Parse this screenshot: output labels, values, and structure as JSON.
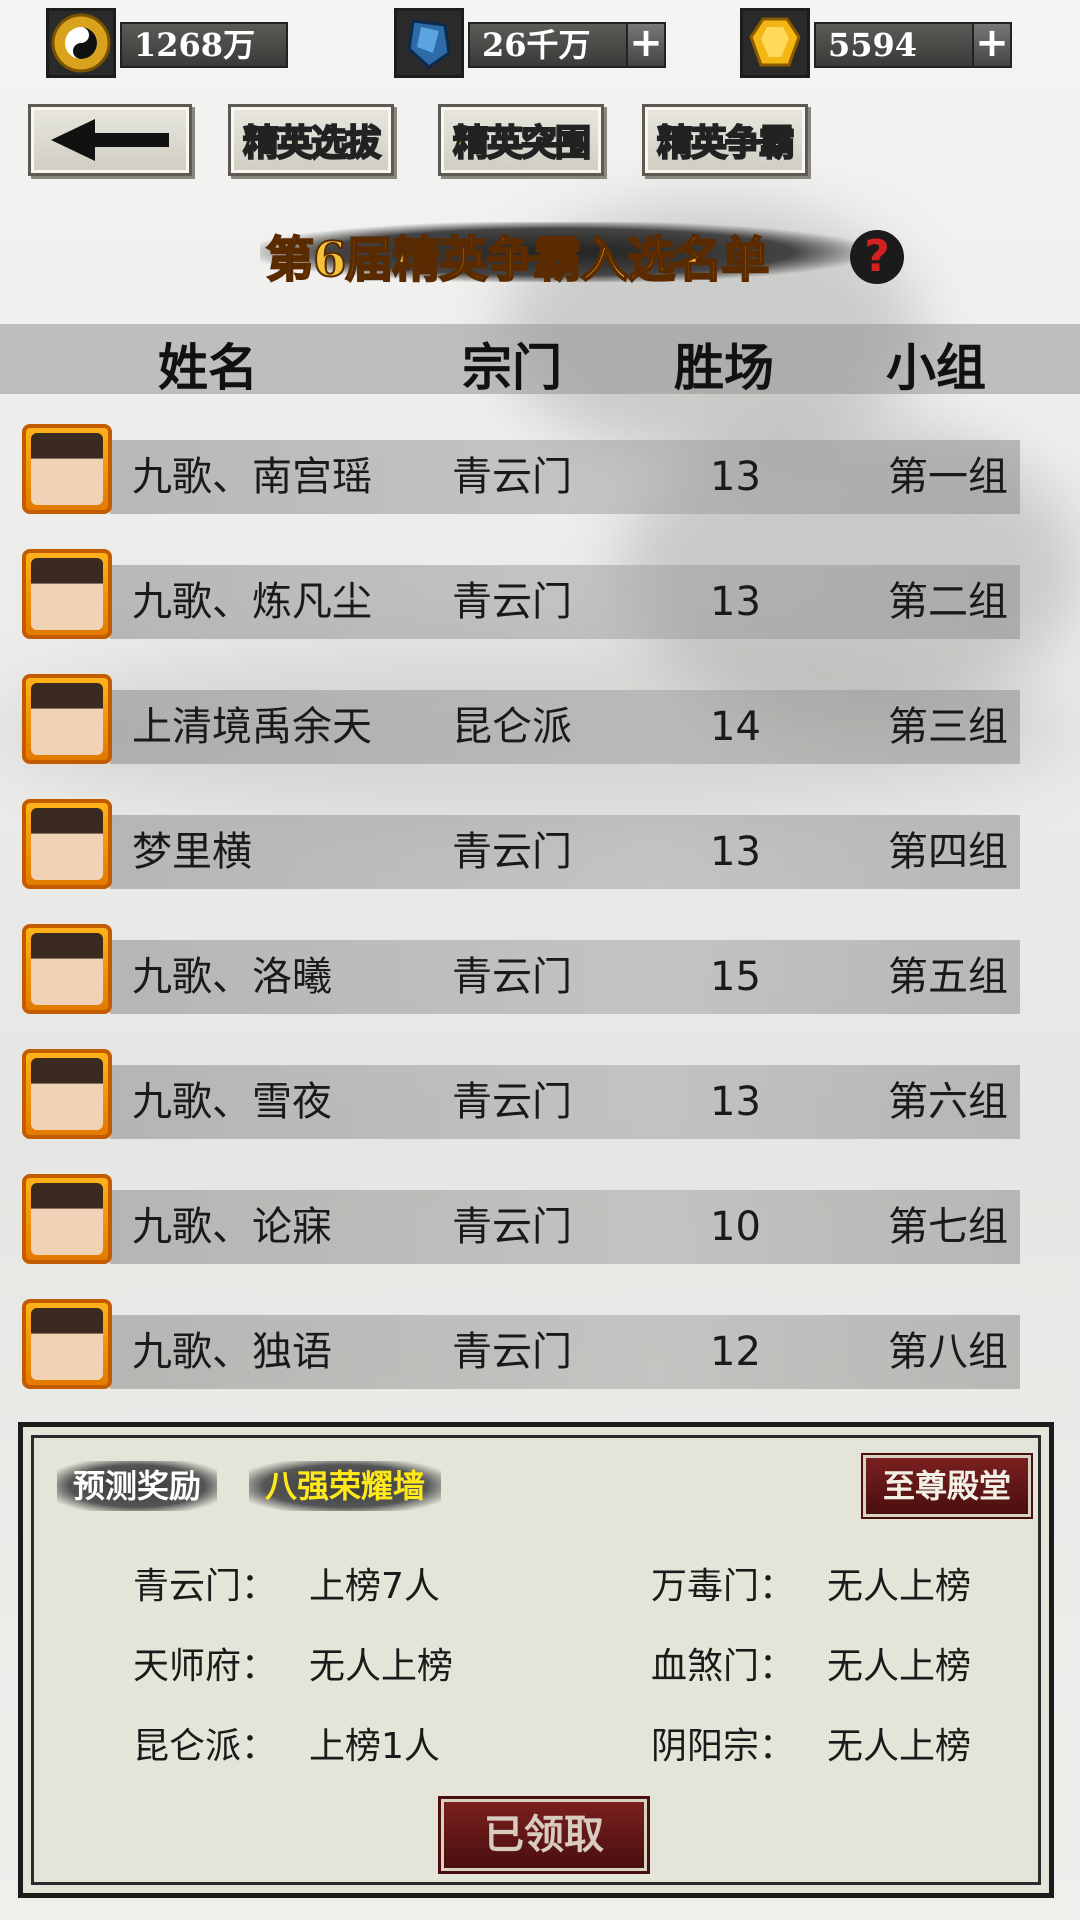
{
  "currency": [
    {
      "icon": "yin-yang-coin-icon",
      "value": "1268万",
      "has_plus": false
    },
    {
      "icon": "blue-crystal-icon",
      "value": "26千万",
      "has_plus": true
    },
    {
      "icon": "gold-gem-icon",
      "value": "5594",
      "has_plus": true
    }
  ],
  "plus_label": "+",
  "nav": {
    "back_icon": "back-arrow-icon",
    "tabs": [
      {
        "label": "精英选拔",
        "active": false
      },
      {
        "label": "精英突围",
        "active": true
      },
      {
        "label": "精英争霸",
        "active": false
      }
    ]
  },
  "title": "第6届精英争霸入选名单",
  "help_label": "?",
  "table": {
    "headers": [
      "姓名",
      "宗门",
      "胜场",
      "小组"
    ],
    "rows": [
      {
        "name": "九歌、南宫瑶",
        "sect": "青云门",
        "wins": "13",
        "group": "第一组"
      },
      {
        "name": "九歌、炼凡尘",
        "sect": "青云门",
        "wins": "13",
        "group": "第二组"
      },
      {
        "name": "上清境禹余天",
        "sect": "昆仑派",
        "wins": "14",
        "group": "第三组"
      },
      {
        "name": "梦里横",
        "sect": "青云门",
        "wins": "13",
        "group": "第四组"
      },
      {
        "name": "九歌、洛曦",
        "sect": "青云门",
        "wins": "15",
        "group": "第五组"
      },
      {
        "name": "九歌、雪夜",
        "sect": "青云门",
        "wins": "13",
        "group": "第六组"
      },
      {
        "name": "九歌、论寐",
        "sect": "青云门",
        "wins": "10",
        "group": "第七组"
      },
      {
        "name": "九歌、独语",
        "sect": "青云门",
        "wins": "12",
        "group": "第八组"
      }
    ]
  },
  "panel": {
    "tag_predict": "预测奖励",
    "tag_wall": "八强荣耀墙",
    "hall_button": "至尊殿堂",
    "sects": [
      {
        "name": "青云门：",
        "result": "上榜7人"
      },
      {
        "name": "万毒门：",
        "result": "无人上榜"
      },
      {
        "name": "天师府：",
        "result": "无人上榜"
      },
      {
        "name": "血煞门：",
        "result": "无人上榜"
      },
      {
        "name": "昆仑派：",
        "result": "上榜1人"
      },
      {
        "name": "阴阳宗：",
        "result": "无人上榜"
      }
    ],
    "claim_button": "已领取"
  },
  "colors": {
    "title": "#f3c23a",
    "active_tab": "#ffe81a",
    "help": "#d32020",
    "hall_button": "#6a1a1a"
  }
}
